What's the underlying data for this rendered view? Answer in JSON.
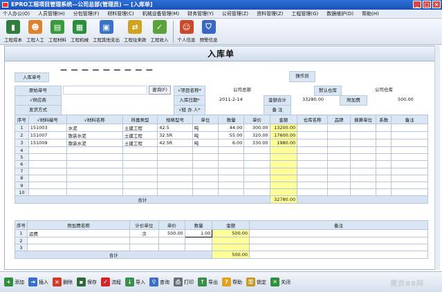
{
  "window": {
    "title": "EPRO工程项目管理系统—公司总部(管理员) — [入库单]",
    "min": "_",
    "max": "□",
    "close": "×"
  },
  "menu": [
    "个人办公(O)",
    "人员管理(H)",
    "分包管理(F)",
    "材料管理(C)",
    "机械设备管理(M)",
    "财务管理(Y)",
    "公司管理(Z)",
    "资料管理(Z)",
    "工程管理(G)",
    "数据维护(D)",
    "帮助(H)"
  ],
  "toolbar": [
    {
      "label": "工程成本",
      "icon": "bar-chart-icon",
      "glyph": "▮",
      "color": "#2f7f3c"
    },
    {
      "label": "工程人工",
      "icon": "workers-icon",
      "glyph": "☻",
      "color": "#e0822a"
    },
    {
      "label": "工程材料",
      "icon": "materials-icon",
      "glyph": "▤",
      "color": "#3b9a3b"
    },
    {
      "label": "工程机械",
      "icon": "machine-icon",
      "glyph": "▦",
      "color": "#2a8f3a"
    },
    {
      "label": "工程其他支出",
      "icon": "expense-icon",
      "glyph": "▣",
      "color": "#3a72c7"
    },
    {
      "label": "工程往来款",
      "icon": "transfer-icon",
      "glyph": "⇄",
      "color": "#d0a21f"
    },
    {
      "label": "工程收入",
      "icon": "income-icon",
      "glyph": "✓",
      "color": "#5aa33a"
    },
    {
      "label": "个人信息",
      "icon": "person-icon",
      "glyph": "☺",
      "color": "#c84a2a"
    },
    {
      "label": "预警信息",
      "icon": "shield-icon",
      "glyph": "⛉",
      "color": "#3a66c4"
    }
  ],
  "page_title": "入库单",
  "form": {
    "receipt_no_label": "入库单号",
    "receipt_no_value": "— — — — — — — — —",
    "operator_label": "操作员",
    "operator_value": "",
    "source_no_label": "原始单号",
    "query_btn": "查询(F)",
    "project_label": "√项目名称*",
    "project_value": "公司总部",
    "warehouse_label": "默认仓库",
    "warehouse_value": "公司仓库",
    "supplier_label": "√供应商",
    "date_label": "入库日期*",
    "date_value": "2011-2-14",
    "amount_label": "金额合计",
    "amount_value": "33280.00",
    "surcharge_label": "附加费",
    "surcharge_value": "500.00",
    "ship_label": "发货方式",
    "handler_label": "√经 办 人*",
    "remark_label": "备    注"
  },
  "items": {
    "headers": [
      "序号",
      "√材料编号",
      "√材料名称",
      "所属类型",
      "规格型号",
      "单位",
      "数量",
      "单价",
      "金额",
      "仓库名称",
      "品牌",
      "换算单位",
      "系数",
      "备注"
    ],
    "rows": [
      [
        "1",
        "151003",
        "水泥",
        "土建工程",
        "42.5",
        "吨",
        "44.00",
        "300.00",
        "13200.00",
        "",
        "",
        "",
        "",
        ""
      ],
      [
        "2",
        "151007",
        "散装水泥",
        "土建工程",
        "32.5R",
        "吨",
        "55.00",
        "320.00",
        "17600.00",
        "",
        "",
        "",
        "",
        ""
      ],
      [
        "3",
        "151009",
        "散装水泥",
        "土建工程",
        "42.5R",
        "吨",
        "6.00",
        "330.00",
        "1980.00",
        "",
        "",
        "",
        "",
        ""
      ],
      [
        "4",
        "",
        "",
        "",
        "",
        "",
        "",
        "",
        "",
        "",
        "",
        "",
        "",
        ""
      ],
      [
        "5",
        "",
        "",
        "",
        "",
        "",
        "",
        "",
        "",
        "",
        "",
        "",
        "",
        ""
      ],
      [
        "6",
        "",
        "",
        "",
        "",
        "",
        "",
        "",
        "",
        "",
        "",
        "",
        "",
        ""
      ],
      [
        "7",
        "",
        "",
        "",
        "",
        "",
        "",
        "",
        "",
        "",
        "",
        "",
        "",
        ""
      ],
      [
        "8",
        "",
        "",
        "",
        "",
        "",
        "",
        "",
        "",
        "",
        "",
        "",
        "",
        ""
      ],
      [
        "9",
        "",
        "",
        "",
        "",
        "",
        "",
        "",
        "",
        "",
        "",
        "",
        "",
        ""
      ],
      [
        "10",
        "",
        "",
        "",
        "",
        "",
        "",
        "",
        "",
        "",
        "",
        "",
        "",
        ""
      ]
    ],
    "total_label": "合计",
    "total_value": "32780.00"
  },
  "fees": {
    "headers": [
      "序号",
      "附加费名称",
      "计价单位",
      "单价",
      "数量",
      "金额",
      "备注"
    ],
    "rows": [
      [
        "1",
        "运费",
        "次",
        "500.00",
        "1.00",
        "500.00",
        ""
      ],
      [
        "2",
        "",
        "",
        "",
        "",
        "",
        ""
      ],
      [
        "3",
        "",
        "",
        "",
        "",
        "",
        ""
      ]
    ],
    "total_label": "合计",
    "total_value": "500.00"
  },
  "bottom": [
    {
      "label": "添加",
      "icon": "add-icon",
      "glyph": "+",
      "color": "#2f8f3a"
    },
    {
      "label": "插入",
      "icon": "insert-icon",
      "glyph": "⇥",
      "color": "#3a6fc9"
    },
    {
      "label": "删除",
      "icon": "delete-icon",
      "glyph": "×",
      "color": "#d23b2b"
    },
    {
      "label": "保存",
      "icon": "save-icon",
      "glyph": "▪",
      "color": "#2f6a36"
    },
    {
      "label": "流程",
      "icon": "flow-icon",
      "glyph": "✓",
      "color": "#d2262a"
    },
    {
      "label": "导入",
      "icon": "import-icon",
      "glyph": "↓",
      "color": "#3c8f4a"
    },
    {
      "label": "查询",
      "icon": "search-icon",
      "glyph": "⚲",
      "color": "#3a6fc9"
    },
    {
      "label": "打印",
      "icon": "print-icon",
      "glyph": "⎙",
      "color": "#6a6f7a"
    },
    {
      "label": "导出",
      "icon": "export-icon",
      "glyph": "↑",
      "color": "#3c8f4a"
    },
    {
      "label": "帮助",
      "icon": "help-icon",
      "glyph": "?",
      "color": "#e0a21f"
    },
    {
      "label": "锁定",
      "icon": "lock-icon",
      "glyph": "⚿",
      "color": "#c89a22"
    },
    {
      "label": "关闭",
      "icon": "close-icon",
      "glyph": "✕",
      "color": "#2f8f3a"
    }
  ],
  "watermark": "黄页88网"
}
